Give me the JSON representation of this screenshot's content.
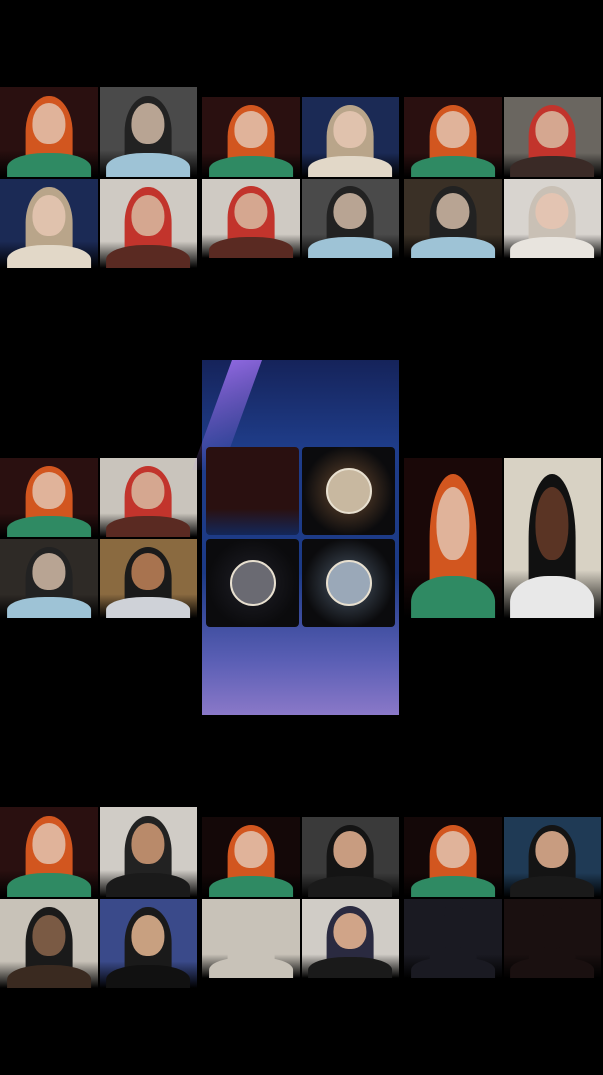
{
  "colors": {
    "background": "#000000",
    "room_dark": "#2a1414",
    "room_light": "#c9c4bc",
    "hair_red": "#d2561f",
    "skin": "#d9a88c",
    "shirt_green": "#2f8a63",
    "space_blue": "#1f3d8a"
  },
  "panels": [
    {
      "tiles": [
        {
          "bg": "#2a1010",
          "hair": "#d2561f",
          "skin": "#e0b39a",
          "shirt": "#2f8a63"
        },
        {
          "bg": "#4a4a4a",
          "hair": "#222222",
          "skin": "#b8a493",
          "shirt": "#9ec3d6"
        },
        {
          "bg": "#1b2a55",
          "hair": "#b9a58a",
          "skin": "#e0c2ad",
          "shirt": "#e2d8c8"
        },
        {
          "bg": "#cfcac3",
          "hair": "#c2342c",
          "skin": "#d5a790",
          "shirt": "#5a2a22"
        }
      ]
    },
    {
      "tiles": [
        {
          "bg": "#2a1010",
          "hair": "#d2561f",
          "skin": "#e0b39a",
          "shirt": "#2f8a63"
        },
        {
          "bg": "#1b2a55",
          "hair": "#b9a58a",
          "skin": "#e0c2ad",
          "shirt": "#e2d8c8"
        },
        {
          "bg": "#cfcac3",
          "hair": "#c2342c",
          "skin": "#d5a790",
          "shirt": "#5a2a22"
        },
        {
          "bg": "#4a4a4a",
          "hair": "#222222",
          "skin": "#b8a493",
          "shirt": "#9ec3d6"
        }
      ]
    },
    {
      "tiles": [
        {
          "bg": "#2a1010",
          "hair": "#d2561f",
          "skin": "#e0b39a",
          "shirt": "#2f8a63"
        },
        {
          "bg": "#6a6660",
          "hair": "#c2342c",
          "skin": "#d5a790",
          "shirt": "#3a2a26"
        },
        {
          "bg": "#3a3026",
          "hair": "#222222",
          "skin": "#b8a493",
          "shirt": "#9ec3d6"
        },
        {
          "bg": "#d8d4cf",
          "hair": "#c9c0b5",
          "skin": "#e3c4b2",
          "shirt": "#e8e4de"
        }
      ]
    },
    {
      "tiles": [
        {
          "bg": "#2a1010",
          "hair": "#d2561f",
          "skin": "#e0b39a",
          "shirt": "#2f8a63"
        },
        {
          "bg": "#c9c4bc",
          "hair": "#c2342c",
          "skin": "#d5a790",
          "shirt": "#5a2a22"
        },
        {
          "bg": "#2e2a26",
          "hair": "#222222",
          "skin": "#b8a493",
          "shirt": "#9ec3d6"
        },
        {
          "bg": "#8a6a40",
          "hair": "#1a1a1a",
          "skin": "#a8734f",
          "shirt": "#cfd2d8"
        }
      ]
    },
    {
      "tiles": [
        {
          "bg": "#1a0808",
          "hair": "#d2561f",
          "skin": "#e0b39a",
          "shirt": "#2f8a63"
        },
        {
          "bg": "#d8d2c4",
          "hair": "#111111",
          "skin": "#5a3424",
          "shirt": "#e8e8e8"
        }
      ]
    },
    {
      "tiles": [
        {
          "bg": "#2a1010",
          "hair": "#d2561f",
          "skin": "#e0b39a",
          "shirt": "#2f8a63"
        },
        {
          "bg": "#d0ccc6",
          "hair": "#222222",
          "skin": "#b98a6a",
          "shirt": "#1a1a1a"
        },
        {
          "bg": "#c8c2b8",
          "hair": "#1a1a1a",
          "skin": "#7a5a44",
          "shirt": "#3a2a20"
        },
        {
          "bg": "#3a4a8a",
          "hair": "#1a1a1a",
          "skin": "#c8a080",
          "shirt": "#111111"
        }
      ]
    },
    {
      "tiles": [
        {
          "bg": "#140808",
          "hair": "#d2561f",
          "skin": "#e0b39a",
          "shirt": "#2f8a63"
        },
        {
          "bg": "#3a3a3a",
          "hair": "#141414",
          "skin": "#c89c80",
          "shirt": "#1a1a1a"
        },
        {
          "bg": "#c8c2b8",
          "hair": "#c8c2b8",
          "skin": "#c8c2b8",
          "shirt": "#c8c2b8"
        },
        {
          "bg": "#d0ccc6",
          "hair": "#2a2a40",
          "skin": "#d0a488",
          "shirt": "#1a1a1a"
        }
      ]
    },
    {
      "tiles": [
        {
          "bg": "#140808",
          "hair": "#d2561f",
          "skin": "#e0b39a",
          "shirt": "#2f8a63"
        },
        {
          "bg": "#1f3a55",
          "hair": "#141414",
          "skin": "#c89c80",
          "shirt": "#1a1a1a"
        },
        {
          "bg": "#1a1a22",
          "hair": "#1a1a22",
          "skin": "#1a1a22",
          "shirt": "#1a1a22"
        },
        {
          "bg": "#1a1010",
          "hair": "#1a1010",
          "skin": "#1a1010",
          "shirt": "#1a1010"
        }
      ]
    }
  ],
  "center_tiles": [
    {
      "type": "person",
      "bg": "#2a1010",
      "hair": "#d2561f",
      "skin": "#e0b39a",
      "shirt": "#2f8a63"
    },
    {
      "type": "avatar-ring",
      "glow": "#6a4a30",
      "inner": "#c8b8a0"
    },
    {
      "type": "avatar-ring",
      "glow": "#202028",
      "inner": "#6a6a72"
    },
    {
      "type": "avatar-ring",
      "glow": "#4a5868",
      "inner": "#9aa8b8"
    }
  ]
}
